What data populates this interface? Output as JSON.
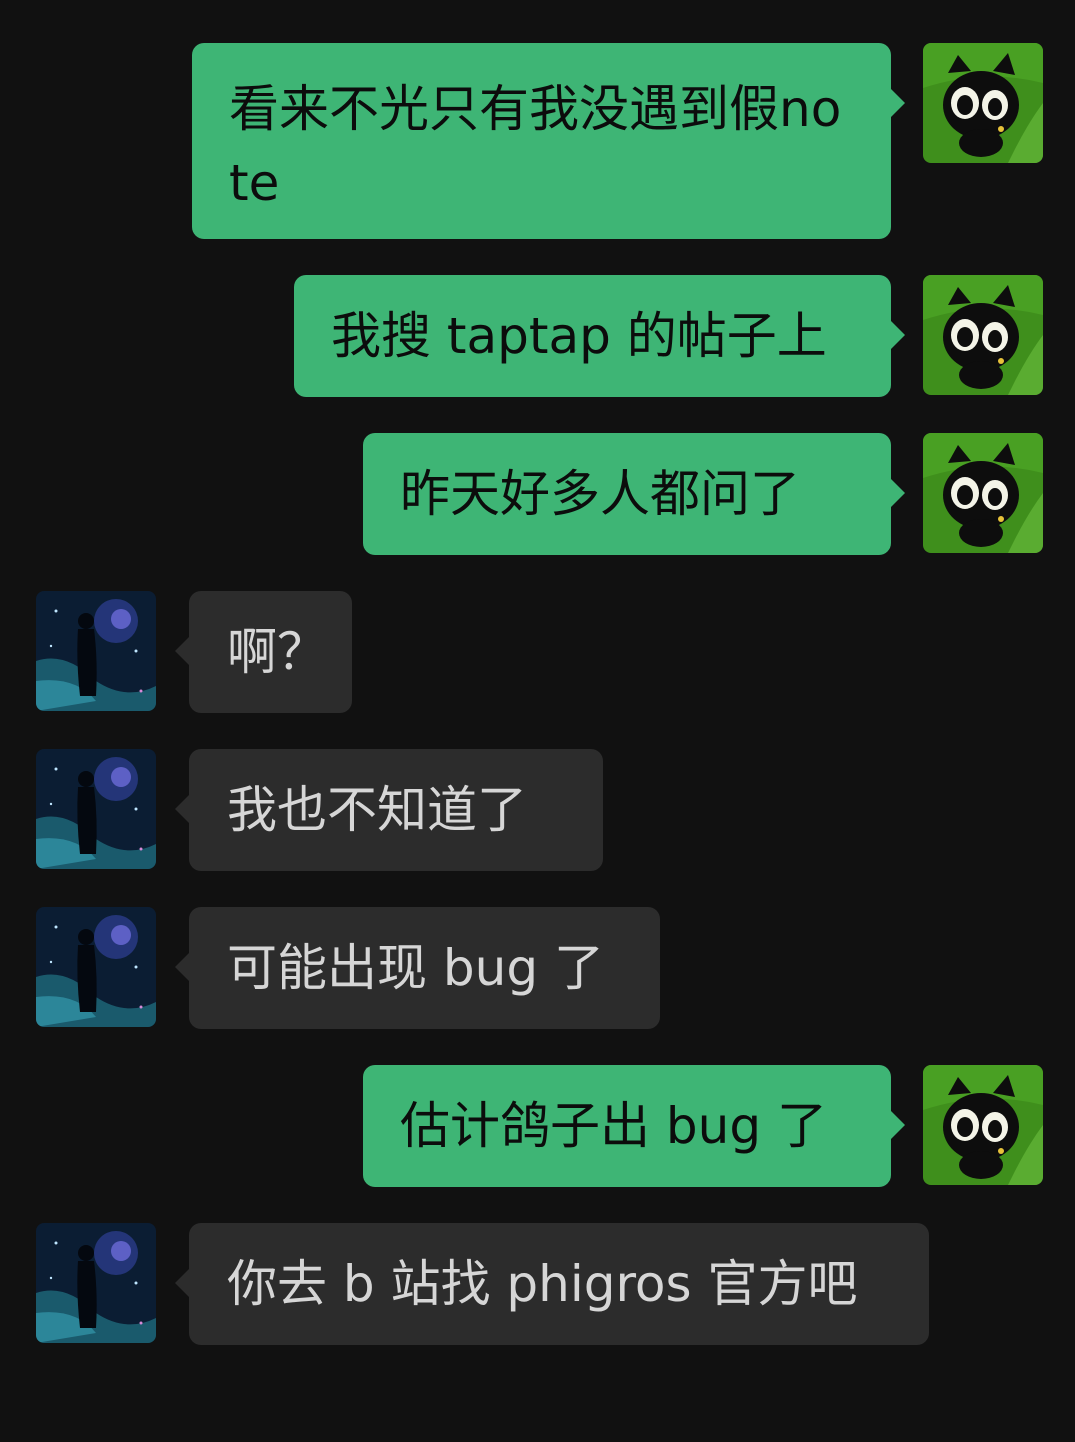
{
  "colors": {
    "background": "#111111",
    "outgoing_bubble": "#3eb575",
    "incoming_bubble": "#2c2c2c",
    "outgoing_text": "#0c0c0c",
    "incoming_text": "#d6d6d6"
  },
  "avatars": {
    "self": "black-cat-avatar-icon",
    "contact": "starry-silhouette-avatar-icon"
  },
  "messages": [
    {
      "direction": "out",
      "text": "看来不光只有我没遇到假note"
    },
    {
      "direction": "out",
      "text": "我搜 taptap 的帖子上"
    },
    {
      "direction": "out",
      "text": "昨天好多人都问了"
    },
    {
      "direction": "in",
      "text": "啊？"
    },
    {
      "direction": "in",
      "text": "我也不知道了"
    },
    {
      "direction": "in",
      "text": "可能出现 bug 了"
    },
    {
      "direction": "out",
      "text": "估计鸽子出 bug 了"
    },
    {
      "direction": "in",
      "text": "你去 b 站找 phigros 官方吧"
    }
  ]
}
